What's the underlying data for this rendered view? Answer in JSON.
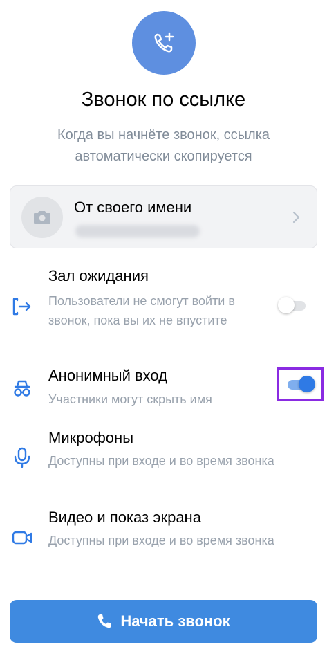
{
  "header": {
    "icon": "phone-add-icon",
    "title": "Звонок по ссылке",
    "subtitle": "Когда вы начнёте звонок, ссылка автоматически скопируется"
  },
  "account": {
    "label": "От своего имени",
    "avatar_icon": "camera-icon",
    "chevron_icon": "chevron-right-icon"
  },
  "options": [
    {
      "icon": "door-enter-icon",
      "title": "Зал ожидания",
      "description": "Пользователи не смогут войти в звонок, пока вы их не впустите",
      "enabled": false
    },
    {
      "icon": "incognito-icon",
      "title": "Анонимный вход",
      "description": "Участники могут скрыть имя",
      "enabled": true
    },
    {
      "icon": "microphone-icon",
      "title": "Микрофоны",
      "description": "Доступны при входе и во время звонка"
    },
    {
      "icon": "video-camera-icon",
      "title": "Видео и показ экрана",
      "description": "Доступны при входе и во время звонка"
    }
  ],
  "start_button": {
    "label": "Начать звонок",
    "icon": "phone-icon"
  },
  "colors": {
    "accent": "#2f7ae5",
    "button": "#3f8ae0",
    "hero": "#5e8fe0",
    "highlight": "#8a2be2"
  }
}
